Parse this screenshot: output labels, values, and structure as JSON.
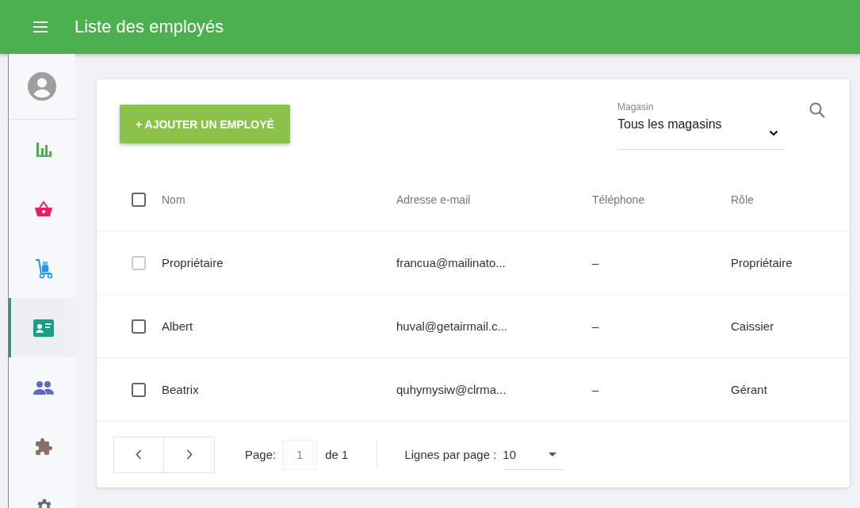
{
  "header": {
    "title": "Liste des employés"
  },
  "sidebar": {
    "items": [
      {
        "kind": "chart",
        "selected": false
      },
      {
        "kind": "basket",
        "selected": false
      },
      {
        "kind": "trolley",
        "selected": false
      },
      {
        "kind": "idcard",
        "selected": true
      },
      {
        "kind": "people",
        "selected": false
      },
      {
        "kind": "puzzle",
        "selected": false
      },
      {
        "kind": "gear",
        "selected": false
      }
    ]
  },
  "toolbar": {
    "add_button": "+ AJOUTER UN EMPLOYÉ",
    "store_filter": {
      "label": "Magasin",
      "value": "Tous les magasins"
    }
  },
  "table": {
    "columns": [
      "Nom",
      "Adresse e-mail",
      "Téléphone",
      "Rôle"
    ],
    "header_checked": false,
    "rows": [
      {
        "checked": false,
        "disabled": true,
        "cells": [
          "Propriétaire",
          "francua@mailinato...",
          "–",
          "Propriétaire"
        ]
      },
      {
        "checked": false,
        "disabled": false,
        "cells": [
          "Albert",
          "huval@getairmail.c...",
          "–",
          "Caissier"
        ]
      },
      {
        "checked": false,
        "disabled": false,
        "cells": [
          "Beatrix",
          "quhymysiw@clrma...",
          "–",
          "Gérant"
        ]
      }
    ]
  },
  "pagination": {
    "page_label": "Page:",
    "page": "1",
    "of": "de 1",
    "rows_label": "Lignes par page :",
    "rows_per_page": "10"
  }
}
